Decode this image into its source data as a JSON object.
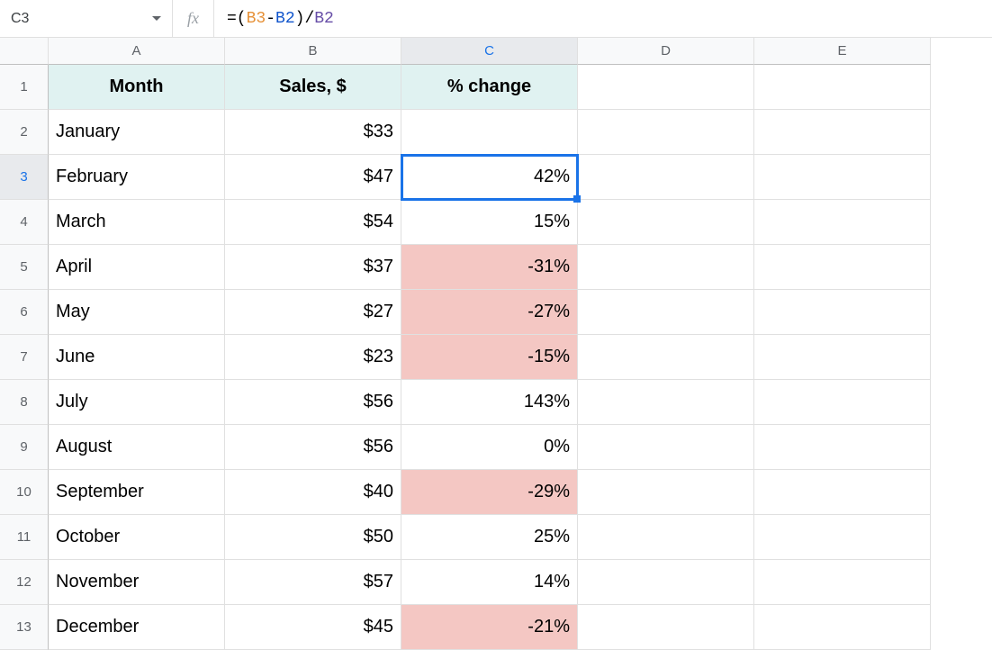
{
  "nameBox": "C3",
  "formula": {
    "parts": [
      "=(",
      "B3",
      "-",
      "B2",
      ")/",
      "B2"
    ]
  },
  "columns": [
    "A",
    "B",
    "C",
    "D",
    "E"
  ],
  "selectedColumn": "C",
  "selectedRow": "3",
  "headers": {
    "month": "Month",
    "sales": "Sales, $",
    "change": "% change"
  },
  "rows": [
    {
      "num": "1"
    },
    {
      "num": "2",
      "month": "January",
      "sales": "$33",
      "change": ""
    },
    {
      "num": "3",
      "month": "February",
      "sales": "$47",
      "change": "42%",
      "selected": true
    },
    {
      "num": "4",
      "month": "March",
      "sales": "$54",
      "change": "15%"
    },
    {
      "num": "5",
      "month": "April",
      "sales": "$37",
      "change": "-31%",
      "neg": true
    },
    {
      "num": "6",
      "month": "May",
      "sales": "$27",
      "change": "-27%",
      "neg": true
    },
    {
      "num": "7",
      "month": "June",
      "sales": "$23",
      "change": "-15%",
      "neg": true
    },
    {
      "num": "8",
      "month": "July",
      "sales": "$56",
      "change": "143%"
    },
    {
      "num": "9",
      "month": "August",
      "sales": "$56",
      "change": "0%"
    },
    {
      "num": "10",
      "month": "September",
      "sales": "$40",
      "change": "-29%",
      "neg": true
    },
    {
      "num": "11",
      "month": "October",
      "sales": "$50",
      "change": "25%"
    },
    {
      "num": "12",
      "month": "November",
      "sales": "$57",
      "change": "14%"
    },
    {
      "num": "13",
      "month": "December",
      "sales": "$45",
      "change": "-21%",
      "neg": true
    }
  ]
}
